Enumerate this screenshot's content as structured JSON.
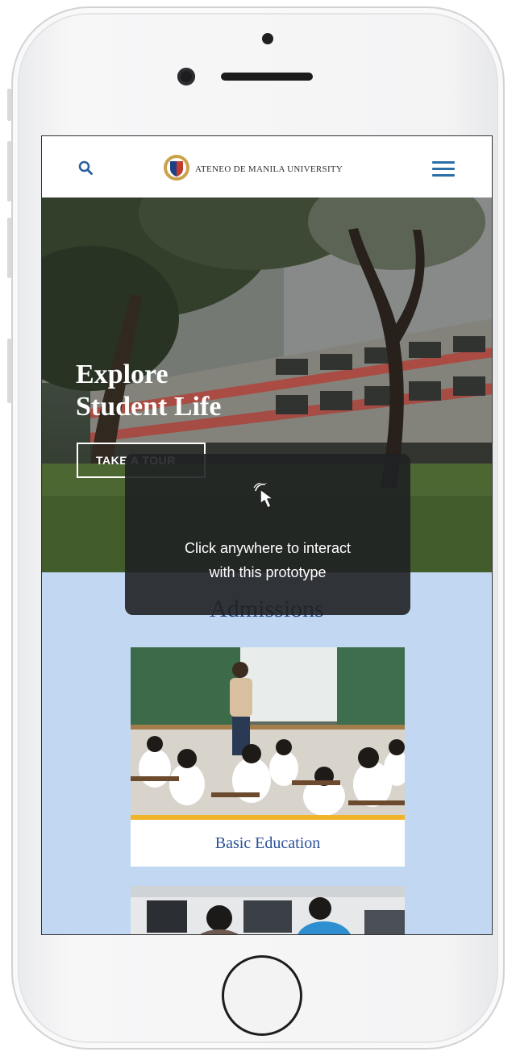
{
  "header": {
    "site_title": "ATENEO DE MANILA UNIVERSITY",
    "search_icon": "search-icon",
    "menu_icon": "hamburger-menu-icon",
    "accent_color": "#2b6ea8"
  },
  "hero": {
    "title_line1": "Explore",
    "title_line2": "Student Life",
    "button_label": "TAKE A TOUR"
  },
  "overlay": {
    "line1": "Click anywhere to interact",
    "line2": "with this prototype",
    "icon": "pointer-cursor-icon"
  },
  "admissions": {
    "heading": "Admissions",
    "cards": [
      {
        "label": "Basic Education"
      }
    ],
    "background_color": "#c2d8f2",
    "stripe_color": "#f0b429"
  }
}
